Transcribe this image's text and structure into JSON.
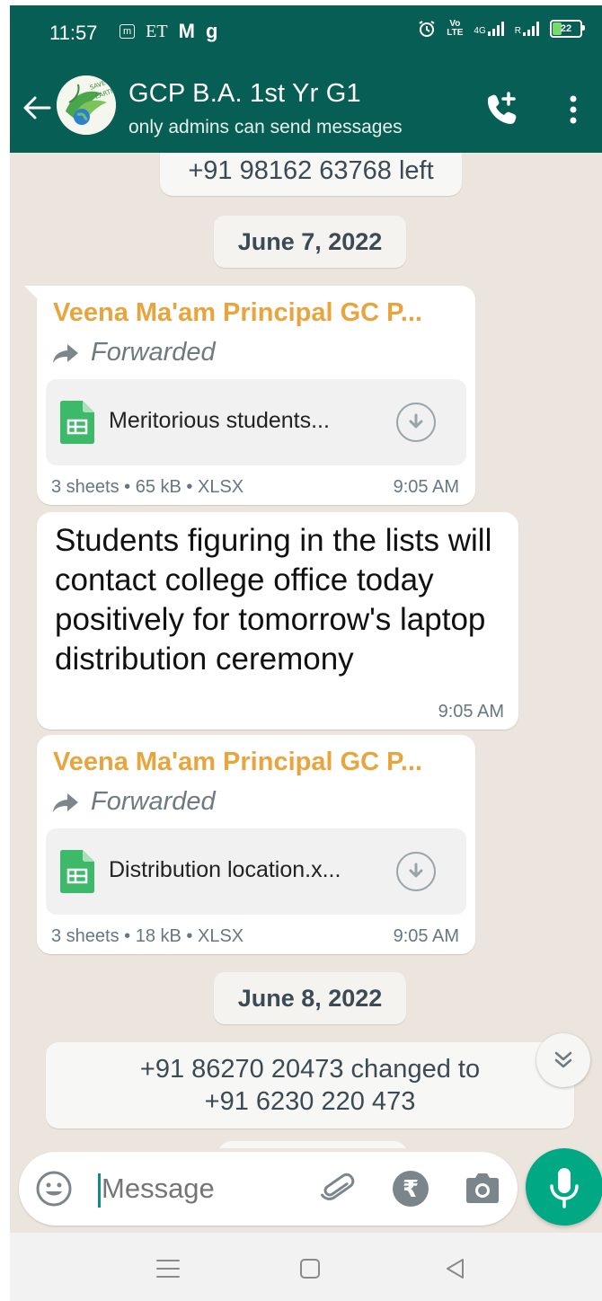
{
  "status_bar": {
    "time": "11:57",
    "carrier_badge": "m",
    "app_et": "ET",
    "app_m": "M",
    "app_g": "g",
    "volte_top": "Vo",
    "volte_bottom": "LTE",
    "network": "4G",
    "roaming": "R",
    "battery": "22"
  },
  "header": {
    "title": "GCP B.A. 1st Yr G1",
    "subtitle": "only admins can send messages",
    "avatar_text": "SAVE EARTH"
  },
  "messages": {
    "system_left": "+91 98162 63768 left",
    "date_1": "June 7, 2022",
    "msg1": {
      "sender": "Veena Ma'am Principal GC P...",
      "forwarded": "Forwarded",
      "file_name": "Meritorious students...",
      "meta": "3 sheets • 65 kB • XLSX",
      "time": "9:05 AM"
    },
    "msg2": {
      "text": "Students figuring in the lists will contact college office today positively for tomorrow's laptop distribution ceremony",
      "time": "9:05 AM"
    },
    "msg3": {
      "sender": "Veena Ma'am Principal GC P...",
      "forwarded": "Forwarded",
      "file_name": "Distribution location.x...",
      "meta": "3 sheets • 18 kB • XLSX",
      "time": "9:05 AM"
    },
    "date_2": "June 8, 2022",
    "system_change_line1": "+91 86270 20473 changed to",
    "system_change_line2": "+91 6230 220 473"
  },
  "composer": {
    "placeholder": "Message",
    "rupee": "₹"
  },
  "colors": {
    "header": "#075e54",
    "accent": "#00a884",
    "sender": "#e8a43d",
    "chat_bg": "#ece5dd"
  }
}
